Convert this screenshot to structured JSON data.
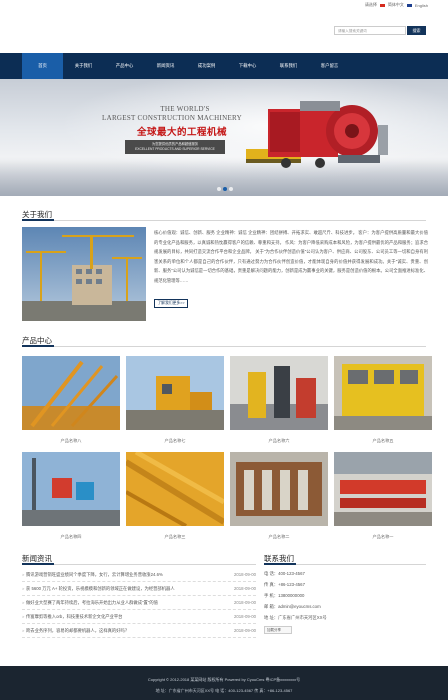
{
  "topbar": {
    "lang_cn": "简体中文",
    "lang_en": "English",
    "lang_prefix": "请选择"
  },
  "search": {
    "placeholder": "请输入搜索关键词",
    "button": "搜索"
  },
  "nav": {
    "items": [
      "首页",
      "关于我们",
      "产品中心",
      "新闻资讯",
      "成功案例",
      "下载中心",
      "联系我们",
      "客户留言"
    ]
  },
  "banner": {
    "line1": "THE WORLD'S",
    "line2": "LARGEST CONSTRUCTION MACHINERY",
    "cn": "全球最大的工程机械",
    "sub1": "为您提供优质的产品和超值服务",
    "sub2": "EXCELLENT PRODUCTS AND SUPERIOR SERVICE",
    "dots": 3,
    "active_dot": 1
  },
  "about": {
    "title": "关于我们",
    "text": "核心价值观：诚信、创新、服务 企业精神：诚信 企业精神：团结拼搏、开拓求实、敢超尺斤、科技进步。 客户：为客户提供高质量和最大价值的专业化产品和服务，以真诚和热忱赢得客户的信赖、尊重和支持。 作风：为客户降低采购成本和风险，为客户提供最优的产品和服务；追求合规发展的目标，共同打造交流合作平台和企业品牌。 关于\"为合作伙伴创造价值\"公司认为客户、供应商、公司股东、公司员工等一切和自身有利害关系的单位和个人都是自己的合作伙伴，只有通过努力为合作伙伴创造价值，才能体现自身的价值并获得发展和成功。关于\"诚实、贵重、创新、服务\"公司认为诚信是一切合作的基础，贵重是解决问题的能力，创新是成为赢事业的关键，服务是创造价值的根本。公司全面推进标准化、规范化管理等……",
    "more": "了解我们更多>>"
  },
  "products": {
    "title": "产品中心",
    "items": [
      "产品名称八",
      "产品名称七",
      "产品名称六",
      "产品名称五",
      "产品名称四",
      "产品名称三",
      "产品名称二",
      "产品名称一"
    ]
  },
  "news": {
    "title": "新闻资讯",
    "items": [
      {
        "text": "腾讯游戏营销旺盛业绩同个季度下降，女行，云计算增业务营收涨24.6%",
        "date": "2018-09-00"
      },
      {
        "text": "获 5600 万元 A+ 轮投资，乐视模模和创新的领域正在做建设，为经营部机器人",
        "date": "2018-09-00"
      },
      {
        "text": "做好业大型赛了两年持续后，考拉海乐开始出力从业人群做成\"置\"的值",
        "date": "2018-09-00"
      },
      {
        "text": "传富摩剪等推入orb，科技重技术新企文化产业平台",
        "date": "2018-09-00"
      },
      {
        "text": "跨去业务序列，容易的却都要机器人，这样真的好吗？",
        "date": "2018-09-00"
      }
    ]
  },
  "contact": {
    "title": "联系我们",
    "phone": "电 话：400-123-4567",
    "fax": "传 真：+86-123-4567",
    "mobile": "手 机：13800000000",
    "email": "邮 箱：admin@eyoucms.com",
    "address": "地 址：广东省广州市天河区XX号",
    "share": "加载分享"
  },
  "footer": {
    "copyright": "Copyright © 2012-2018 某某网站 版权所有 Powered by CyouCms 粤ICP备xxxxxxxx号",
    "address": "地 址：广东省广州市天河区XX号  电 话：400-123-4567  传 真：+86-123-4567"
  },
  "colors": {
    "nav_bg": "#0c2d54",
    "nav_active": "#1a5ea8",
    "banner_cn": "#c41616",
    "footer_bg": "#1b2530"
  }
}
